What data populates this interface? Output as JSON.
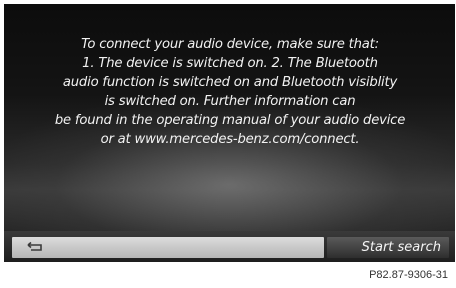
{
  "message": {
    "lines": [
      "To connect your audio device, make sure that:",
      "1. The device is switched on. 2. The Bluetooth",
      "audio function is switched on and Bluetooth visiblity",
      "is switched on. Further information can",
      "be found in the operating manual of your audio device",
      "or at www.mercedes-benz.com/connect."
    ]
  },
  "bottom_bar": {
    "back_icon": "back-arrow-icon",
    "start_search_label": "Start search"
  },
  "reference_code": "P82.87-9306-31"
}
